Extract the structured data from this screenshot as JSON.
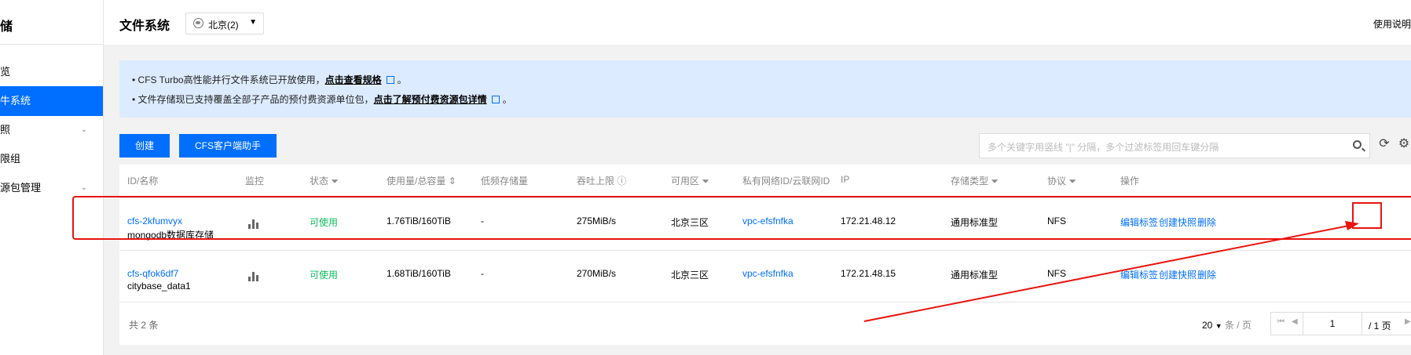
{
  "sidebar": {
    "title": "储",
    "items": [
      {
        "label": "览"
      },
      {
        "label": "牛系统"
      },
      {
        "label": "照"
      },
      {
        "label": "限组"
      },
      {
        "label": "源包管理"
      }
    ]
  },
  "header": {
    "title": "文件系统",
    "region": "北京(2)",
    "help": "使用说明"
  },
  "notice": {
    "line1_text": "CFS Turbo高性能并行文件系统已开放使用，",
    "line1_link": "点击查看规格",
    "line2_text": "文件存储现已支持覆盖全部子产品的预付费资源单位包，",
    "line2_link": "点击了解预付费资源包详情",
    "period": "。"
  },
  "toolbar": {
    "create_label": "创建",
    "assistant_label": "CFS客户端助手",
    "search_placeholder": "多个关键字用竖线 \"|\" 分隔，多个过滤标签用回车键分隔"
  },
  "table": {
    "columns": [
      "ID/名称",
      "监控",
      "状态",
      "使用量/总容量",
      "低频存储量",
      "吞吐上限",
      "可用区",
      "私有网络ID/云联网ID",
      "IP",
      "存储类型",
      "协议",
      "操作"
    ],
    "rows": [
      {
        "id": "cfs-2kfumvyx",
        "name": "mongodb数据库存储",
        "status": "可使用",
        "usage": "1.76TiB/160TiB",
        "low_freq": "-",
        "throughput": "275MiB/s",
        "zone": "北京三区",
        "vpc": "vpc-efsfnfka",
        "ip": "172.21.48.12",
        "storage_type": "通用标准型",
        "protocol": "NFS",
        "op_tags": "编辑标签",
        "op_snapshot": "创建快照",
        "op_delete": "删除"
      },
      {
        "id": "cfs-qfok6df7",
        "name": "citybase_data1",
        "status": "可使用",
        "usage": "1.68TiB/160TiB",
        "low_freq": "-",
        "throughput": "270MiB/s",
        "zone": "北京三区",
        "vpc": "vpc-efsfnfka",
        "ip": "172.21.48.15",
        "storage_type": "通用标准型",
        "protocol": "NFS",
        "op_tags": "编辑标签",
        "op_snapshot": "创建快照",
        "op_delete": "删除"
      }
    ]
  },
  "footer": {
    "total": "共 2 条",
    "page_size": "20",
    "page_size_unit": "条 / 页",
    "current_page": "1",
    "total_pages": "/ 1 页"
  },
  "colors": {
    "primary": "#006eff",
    "success": "#0abf5b",
    "annotation": "#e8140f",
    "notice_bg": "#dcebff"
  }
}
